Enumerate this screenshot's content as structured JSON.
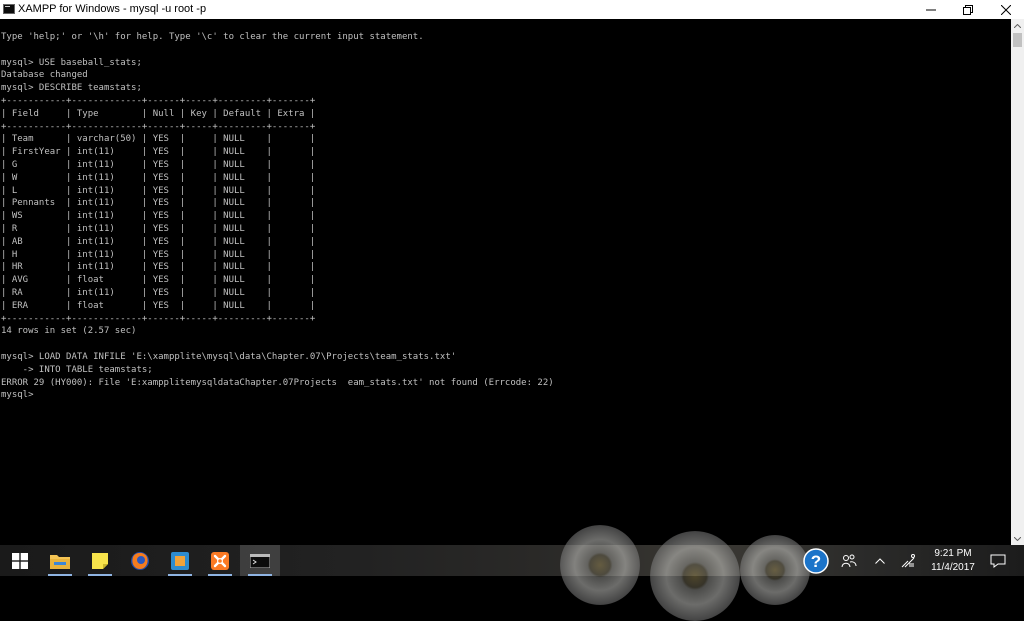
{
  "window": {
    "title": "XAMPP for Windows - mysql  -u root -p"
  },
  "console": {
    "lines": [
      "Type 'help;' or '\\h' for help. Type '\\c' to clear the current input statement.",
      "",
      "mysql> USE baseball_stats;",
      "Database changed",
      "mysql> DESCRIBE teamstats;",
      "+-----------+-------------+------+-----+---------+-------+",
      "| Field     | Type        | Null | Key | Default | Extra |",
      "+-----------+-------------+------+-----+---------+-------+",
      "| Team      | varchar(50) | YES  |     | NULL    |       |",
      "| FirstYear | int(11)     | YES  |     | NULL    |       |",
      "| G         | int(11)     | YES  |     | NULL    |       |",
      "| W         | int(11)     | YES  |     | NULL    |       |",
      "| L         | int(11)     | YES  |     | NULL    |       |",
      "| Pennants  | int(11)     | YES  |     | NULL    |       |",
      "| WS        | int(11)     | YES  |     | NULL    |       |",
      "| R         | int(11)     | YES  |     | NULL    |       |",
      "| AB        | int(11)     | YES  |     | NULL    |       |",
      "| H         | int(11)     | YES  |     | NULL    |       |",
      "| HR        | int(11)     | YES  |     | NULL    |       |",
      "| AVG       | float       | YES  |     | NULL    |       |",
      "| RA        | int(11)     | YES  |     | NULL    |       |",
      "| ERA       | float       | YES  |     | NULL    |       |",
      "+-----------+-------------+------+-----+---------+-------+",
      "14 rows in set (2.57 sec)",
      "",
      "mysql> LOAD DATA INFILE 'E:\\xampplite\\mysql\\data\\Chapter.07\\Projects\\team_stats.txt'",
      "    -> INTO TABLE teamstats;",
      "ERROR 29 (HY000): File 'E:xampplitemysqldataChapter.07Projects  eam_stats.txt' not found (Errcode: 22)",
      "mysql>"
    ]
  },
  "taskbar": {
    "items": [
      "start",
      "file-explorer",
      "sticky-notes",
      "firefox",
      "xampp-control",
      "xampp-alt",
      "console"
    ],
    "clock": {
      "time": "9:21 PM",
      "date": "11/4/2017"
    }
  },
  "colors": {
    "console_bg": "#000000",
    "console_text": "#c0c0c0",
    "titlebar_bg": "#ffffff",
    "accent": "#8fb4e3",
    "help_icon_bg": "#1c74c9"
  }
}
